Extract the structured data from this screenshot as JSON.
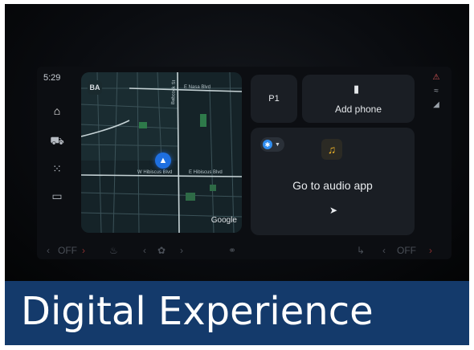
{
  "status": {
    "time": "5:29"
  },
  "sidebar": {
    "items": [
      {
        "icon": "home-icon",
        "glyph": "⌂"
      },
      {
        "icon": "car-icon",
        "glyph": "⛟"
      },
      {
        "icon": "apps-grid-icon",
        "glyph": "⁙"
      },
      {
        "icon": "vehicle-info-icon",
        "glyph": "▭"
      }
    ]
  },
  "map": {
    "badge": "BA",
    "streets": [
      "E Nasa Blvd",
      "W Hibiscus Blvd",
      "E Hibiscus Blvd",
      "Babcock St"
    ],
    "attribution": "Google"
  },
  "profile": {
    "label": "P1"
  },
  "phone": {
    "label": "Add phone"
  },
  "audio": {
    "label": "Go to audio app"
  },
  "climate": {
    "left_label": "OFF",
    "right_label": "OFF"
  },
  "banner": {
    "title": "Digital Experience"
  },
  "colors": {
    "accent": "#1e6fe0",
    "banner": "#143a6b",
    "music": "#f0b429",
    "alert": "#e05a5a"
  }
}
